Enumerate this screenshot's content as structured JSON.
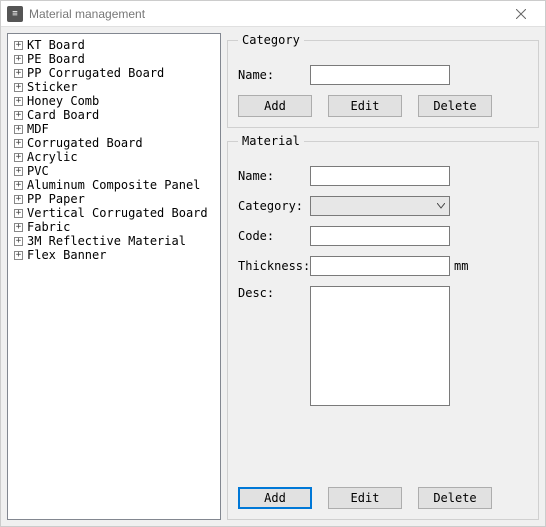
{
  "window": {
    "title": "Material management",
    "icon": "list-icon"
  },
  "tree": {
    "items": [
      {
        "label": "KT Board"
      },
      {
        "label": "PE Board"
      },
      {
        "label": "PP Corrugated Board"
      },
      {
        "label": "Sticker"
      },
      {
        "label": "Honey Comb"
      },
      {
        "label": "Card Board"
      },
      {
        "label": "MDF"
      },
      {
        "label": "Corrugated Board"
      },
      {
        "label": "Acrylic"
      },
      {
        "label": "PVC"
      },
      {
        "label": "Aluminum Composite Panel"
      },
      {
        "label": "PP Paper"
      },
      {
        "label": "Vertical Corrugated Board"
      },
      {
        "label": "Fabric"
      },
      {
        "label": "3M Reflective Material"
      },
      {
        "label": "Flex Banner"
      }
    ]
  },
  "category": {
    "legend": "Category",
    "name_label": "Name:",
    "name_value": "",
    "btn_add": "Add",
    "btn_edit": "Edit",
    "btn_delete": "Delete"
  },
  "material": {
    "legend": "Material",
    "name_label": "Name:",
    "name_value": "",
    "category_label": "Category:",
    "category_value": "",
    "code_label": "Code:",
    "code_value": "",
    "thickness_label": "Thickness:",
    "thickness_value": "",
    "thickness_unit": "mm",
    "desc_label": "Desc:",
    "desc_value": "",
    "btn_add": "Add",
    "btn_edit": "Edit",
    "btn_delete": "Delete"
  }
}
